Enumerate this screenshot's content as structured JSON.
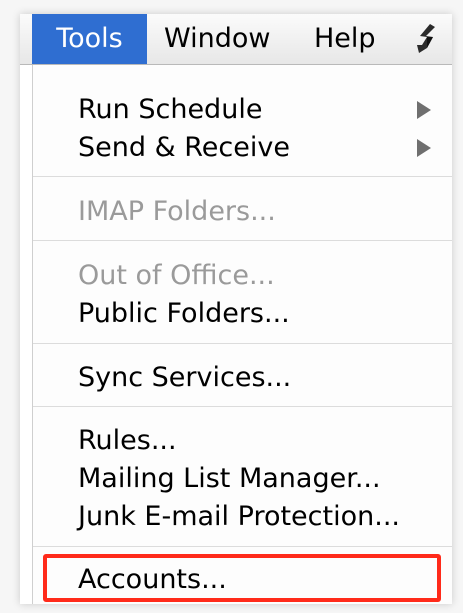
{
  "menubar": {
    "tools": "Tools",
    "window": "Window",
    "help": "Help",
    "script_icon": "script-menu-icon"
  },
  "menu": {
    "run_schedule": "Run Schedule",
    "send_receive": "Send & Receive",
    "imap_folders": "IMAP Folders...",
    "out_of_office": "Out of Office...",
    "public_folders": "Public Folders...",
    "sync_services": "Sync Services...",
    "rules": "Rules...",
    "mailing_list_manager": "Mailing List Manager...",
    "junk_email_protection": "Junk E-mail Protection...",
    "accounts": "Accounts..."
  },
  "colors": {
    "selected_menu": "#2f6ed1",
    "highlight_box": "#ff2a1a",
    "disabled_text": "#9a9a9a"
  }
}
